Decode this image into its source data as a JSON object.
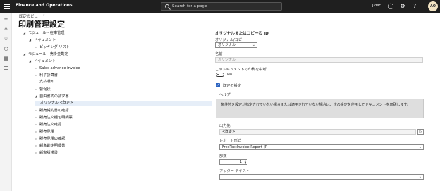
{
  "topbar": {
    "app_name": "Finance and Operations",
    "search_placeholder": "Search for a page",
    "company": "JPMF",
    "avatar_initials": "AO"
  },
  "header": {
    "view_selector": "既定のビュー ˅",
    "page_title": "印刷管理設定"
  },
  "tree": [
    {
      "label": "モジュール - 在庫管理",
      "level": 0,
      "state": "expanded"
    },
    {
      "label": "ドキュメント",
      "level": 1,
      "state": "expanded"
    },
    {
      "label": "ピッキング リスト",
      "level": 2,
      "state": "collapsed"
    },
    {
      "label": "モジュール - 売掛金勘定",
      "level": 0,
      "state": "expanded"
    },
    {
      "label": "ドキュメント",
      "level": 1,
      "state": "expanded"
    },
    {
      "label": "Sales advance invoice",
      "level": 2,
      "state": "collapsed"
    },
    {
      "label": "利子計算書",
      "level": 2,
      "state": "collapsed"
    },
    {
      "label": "支払通知",
      "level": 2,
      "state": "leaf"
    },
    {
      "label": "督促状",
      "level": 2,
      "state": "collapsed"
    },
    {
      "label": "自由書式の請求書",
      "level": 2,
      "state": "expanded"
    },
    {
      "label": "オリジナル <既定>",
      "level": 3,
      "state": "leaf",
      "selected": true
    },
    {
      "label": "販売契約書の確認",
      "level": 2,
      "state": "collapsed"
    },
    {
      "label": "販売注文梱包明細票",
      "level": 2,
      "state": "collapsed"
    },
    {
      "label": "販売注文確認",
      "level": 2,
      "state": "collapsed"
    },
    {
      "label": "販売見積",
      "level": 2,
      "state": "collapsed"
    },
    {
      "label": "販売見積の確認",
      "level": 2,
      "state": "collapsed"
    },
    {
      "label": "顧客勘定明細書",
      "level": 2,
      "state": "collapsed"
    },
    {
      "label": "顧客請求書",
      "level": 2,
      "state": "collapsed"
    }
  ],
  "form": {
    "section_title": "オリジナルまたはコピーの ID",
    "original_copy_label": "オリジナル/コピー",
    "original_copy_value": "オリジナル",
    "name_label": "名前",
    "name_value": "オリジナル",
    "suspend_label": "このドキュメントの印刷を中断",
    "suspend_value": "No",
    "default_settings_label": "既定の設定",
    "help_label": "ヘルプ",
    "help_text": "条件付き設定が指定されていない場合または適用されていない場合は、次の設定を使用してドキュメントを印刷します。",
    "destination_label": "出力先",
    "destination_value": "<既定>",
    "destination_button": "▷",
    "report_format_label": "レポート形式",
    "report_format_value": "FreeTextInvoice.Report_JP",
    "copies_label": "部数",
    "copies_value": "1",
    "footer_text_label": "フッター テキスト",
    "footer_text_value": ""
  }
}
